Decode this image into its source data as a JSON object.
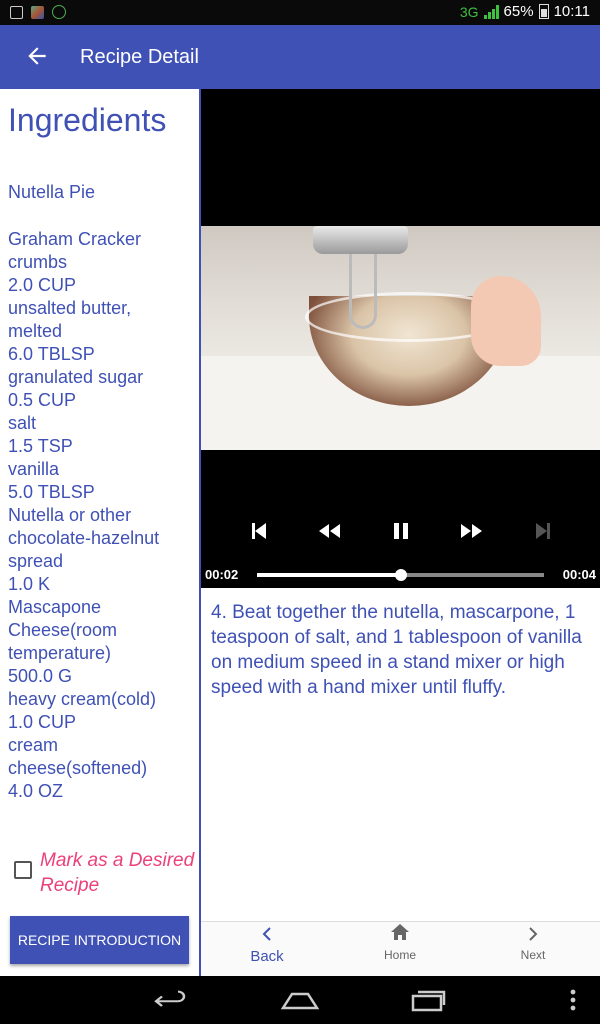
{
  "status_bar": {
    "network": "3G",
    "battery": "65%",
    "time": "10:11"
  },
  "app_bar": {
    "title": "Recipe Detail"
  },
  "ingredients": {
    "heading": "Ingredients",
    "recipe_name": "Nutella Pie",
    "items": [
      "Graham Cracker\ncrumbs",
      "2.0 CUP",
      "unsalted butter,\nmelted",
      "6.0 TBLSP",
      "granulated sugar",
      "0.5 CUP",
      "salt",
      "1.5 TSP",
      "vanilla",
      "5.0 TBLSP",
      "Nutella or other\nchocolate-hazelnut\nspread",
      "1.0 K",
      "Mascapone\nCheese(room\ntemperature)",
      "500.0 G",
      "heavy cream(cold)",
      "1.0 CUP",
      "cream\ncheese(softened)",
      "4.0 OZ"
    ]
  },
  "desired": {
    "label": "Mark as a Desired Recipe",
    "checked": false
  },
  "intro_button": {
    "label": "RECIPE INTRODUCTION"
  },
  "player": {
    "position": "00:02",
    "duration": "00:04",
    "progress": 0.5
  },
  "step": {
    "text": "4. Beat together the nutella, mascarpone, 1 teaspoon of salt, and 1 tablespoon of vanilla on medium speed in a stand mixer or high speed with a hand mixer until fluffy."
  },
  "bottom_nav": {
    "back": "Back",
    "home": "Home",
    "next": "Next"
  },
  "colors": {
    "primary": "#3f51b5",
    "accent": "#ec407a"
  }
}
